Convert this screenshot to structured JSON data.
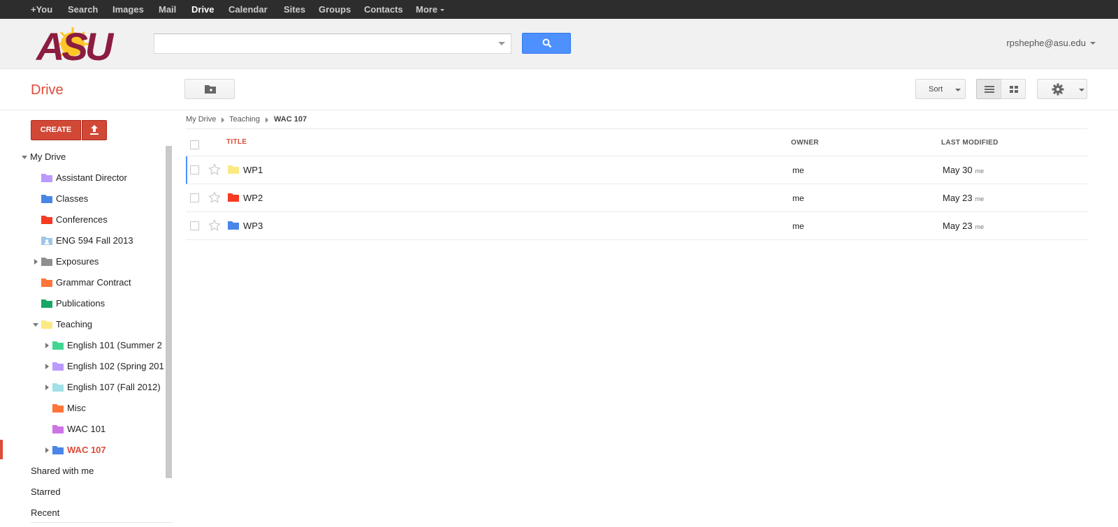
{
  "gbar": {
    "items": [
      "+You",
      "Search",
      "Images",
      "Mail",
      "Drive",
      "Calendar",
      "Sites",
      "Groups",
      "Contacts",
      "More"
    ]
  },
  "header": {
    "logo_text": "ASU",
    "search_value": "",
    "user_email": "rpshephe@asu.edu",
    "logo_color": "#8c1d40",
    "logo_sun_color": "#ffc627"
  },
  "toolbar": {
    "app_title": "Drive",
    "sort_label": "Sort"
  },
  "sidebar": {
    "create_label": "CREATE",
    "my_drive": "My Drive",
    "folders": [
      {
        "label": "Assistant Director",
        "color": "#b99aff"
      },
      {
        "label": "Classes",
        "color": "#4986e7"
      },
      {
        "label": "Conferences",
        "color": "#f83a22"
      },
      {
        "label": "ENG 594 Fall 2013",
        "color": "#9fc6e7"
      },
      {
        "label": "Exposures",
        "color": "#8f8f8f"
      },
      {
        "label": "Grammar Contract",
        "color": "#ff7537"
      },
      {
        "label": "Publications",
        "color": "#16a765"
      },
      {
        "label": "Teaching",
        "color": "#fbe983"
      },
      {
        "label": "English 101 (Summer 2",
        "color": "#42d692"
      },
      {
        "label": "English 102 (Spring 201",
        "color": "#b99aff"
      },
      {
        "label": "English 107 (Fall 2012)",
        "color": "#9fe1e7"
      },
      {
        "label": "Misc",
        "color": "#ff7537"
      },
      {
        "label": "WAC 101",
        "color": "#cd74e6"
      },
      {
        "label": "WAC 107",
        "color": "#4986e7"
      }
    ],
    "links": [
      "Shared with me",
      "Starred",
      "Recent"
    ]
  },
  "breadcrumb": [
    "My Drive",
    "Teaching",
    "WAC 107"
  ],
  "list": {
    "columns": [
      "TITLE",
      "OWNER",
      "LAST MODIFIED"
    ],
    "rows": [
      {
        "name": "WP1",
        "owner": "me",
        "modified": "May 30",
        "modified_by": "me",
        "color": "#fbe983"
      },
      {
        "name": "WP2",
        "owner": "me",
        "modified": "May 23",
        "modified_by": "me",
        "color": "#f83a22"
      },
      {
        "name": "WP3",
        "owner": "me",
        "modified": "May 23",
        "modified_by": "me",
        "color": "#4986e7"
      }
    ]
  }
}
